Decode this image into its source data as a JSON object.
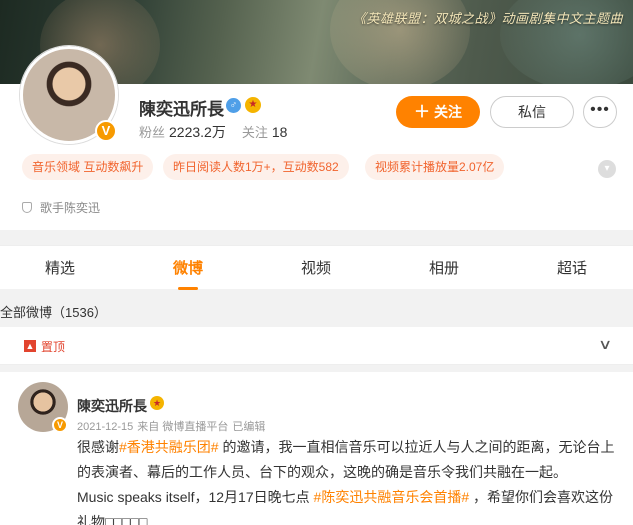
{
  "banner": {
    "caption": "《英雄联盟：双城之战》动画剧集中文主题曲"
  },
  "profile": {
    "name": "陳奕迅所長",
    "gender_icon": "male-icon",
    "followers_label": "粉丝",
    "followers_value": "2223.2万",
    "following_label": "关注",
    "following_value": "18",
    "follow_button": "关注",
    "message_button": "私信",
    "more_button": "more-icon",
    "bio": "歌手陈奕迅"
  },
  "tags": [
    "音乐领域 互动数飙升",
    "昨日阅读人数1万+，互动数582",
    "视频累计播放量2.07亿"
  ],
  "tabs": [
    "精选",
    "微博",
    "视频",
    "相册",
    "超话"
  ],
  "active_tab": "微博",
  "section": {
    "title": "全部微博（1536）"
  },
  "pinned": {
    "label": "置顶"
  },
  "post": {
    "author": "陳奕迅所長",
    "date": "2021-12-15",
    "source": "来自 微博直播平台",
    "edited": "已编辑",
    "text_part1": "很感谢",
    "hashtag1": "#香港共融乐团#",
    "text_part2": " 的邀请，我一直相信音乐可以拉近人与人之间的距离，无论台上的表演者、幕后的工作人员、台下的观众，这晚的确是音乐令我们共融在一起。",
    "text_part3": "Music speaks itself，12月17日晚七点 ",
    "hashtag2": "#陈奕迅共融音乐会首播#",
    "text_part4": " ，希望你们会喜欢这份礼物□□□□□"
  },
  "colors": {
    "accent": "#ff8200",
    "tag_text": "#f1642e",
    "tag_bg": "#fdf0ea",
    "pin": "#e2442e"
  }
}
